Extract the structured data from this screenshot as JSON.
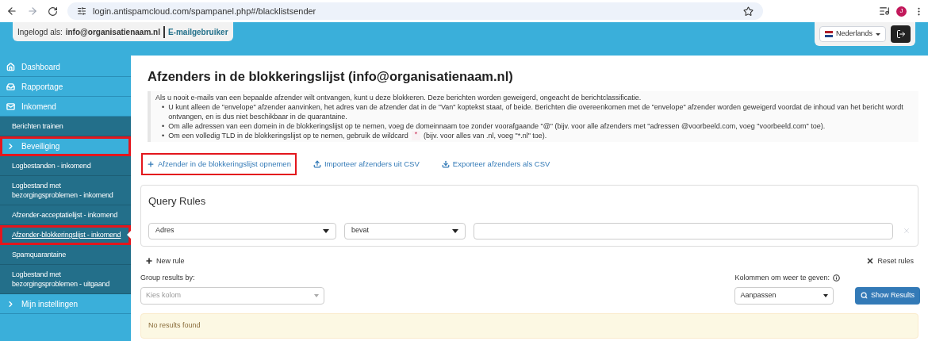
{
  "browser": {
    "url": "login.antispamcloud.com/spampanel.php#/blacklistsender",
    "profile_initial": "J"
  },
  "header": {
    "login_label": "Ingelogd als:",
    "login_user": "info@organisatienaam.nl",
    "login_role": "E-mailgebruiker",
    "language": "Nederlands"
  },
  "sidebar": {
    "items": [
      {
        "label": "Dashboard",
        "kind": "section",
        "selected": false,
        "highlighted": false
      },
      {
        "label": "Rapportage",
        "kind": "section",
        "selected": false,
        "highlighted": false
      },
      {
        "label": "Inkomend",
        "kind": "section",
        "selected": false,
        "highlighted": false
      },
      {
        "label": "Berichten trainen",
        "kind": "sub",
        "selected": false,
        "highlighted": false
      },
      {
        "label": "Beveiliging",
        "kind": "group",
        "selected": false,
        "highlighted": true
      },
      {
        "label": "Logbestanden - inkomend",
        "kind": "sub",
        "selected": false,
        "highlighted": false
      },
      {
        "label": "Logbestand met bezorgingsproblemen - inkomend",
        "kind": "sub",
        "selected": false,
        "highlighted": false
      },
      {
        "label": "Afzender-acceptatielijst - inkomend",
        "kind": "sub",
        "selected": false,
        "highlighted": false
      },
      {
        "label": "Afzender-blokkeringslijst - inkomend",
        "kind": "sub",
        "selected": true,
        "highlighted": true
      },
      {
        "label": "Spamquarantaine",
        "kind": "sub",
        "selected": false,
        "highlighted": false
      },
      {
        "label": "Logbestand met bezorgingsproblemen - uitgaand",
        "kind": "sub",
        "selected": false,
        "highlighted": false
      },
      {
        "label": "Mijn instellingen",
        "kind": "group",
        "selected": false,
        "highlighted": false
      }
    ]
  },
  "page": {
    "title": "Afzenders in de blokkeringslijst (info@organisatienaam.nl)",
    "intro": "Als u nooit e-mails van een bepaalde afzender wilt ontvangen, kunt u deze blokkeren. Deze berichten worden geweigerd, ongeacht de berichtclassificatie.",
    "bullet_marker": "•",
    "bullets": [
      "U kunt alleen de \"envelope\" afzender aanvinken, het adres van de afzender dat in de \"Van\" koptekst staat, of beide. Berichten die overeenkomen met de \"envelope\" afzender worden geweigerd voordat de inhoud van het bericht wordt ontvangen, en is dus niet beschikbaar in de quarantaine.",
      "Om alle adressen van een domein in de blokkeringslijst op te nemen, voeg de domeinnaam toe zonder voorafgaande \"@\" (bijv. voor alle afzenders met \"adressen @voorbeeld.com, voeg \"voorbeeld.com\" toe).",
      "Om een volledig TLD in de blokkeringslijst op te nemen, gebruik de wildcard"
    ],
    "wildcard": "*",
    "wildcard_after": "(bijv. voor alles van .nl, voeg \"*.nl\" toe).",
    "actions": [
      {
        "label": "Afzender in de blokkeringslijst opnemen",
        "kind": "add",
        "highlighted": true
      },
      {
        "label": "Importeer afzenders uit CSV",
        "kind": "upload",
        "highlighted": false
      },
      {
        "label": "Exporteer afzenders als CSV",
        "kind": "download",
        "highlighted": false
      }
    ]
  },
  "query": {
    "title": "Query Rules",
    "field": "Adres",
    "operator": "bevat",
    "new_rule": "New rule",
    "reset_rules": "Reset rules"
  },
  "group_by": {
    "label": "Group results by:",
    "placeholder": "Kies kolom"
  },
  "columns": {
    "label": "Kolommen om weer te geven:",
    "value": "Aanpassen"
  },
  "show_results": "Show Results",
  "message": "No results found"
}
